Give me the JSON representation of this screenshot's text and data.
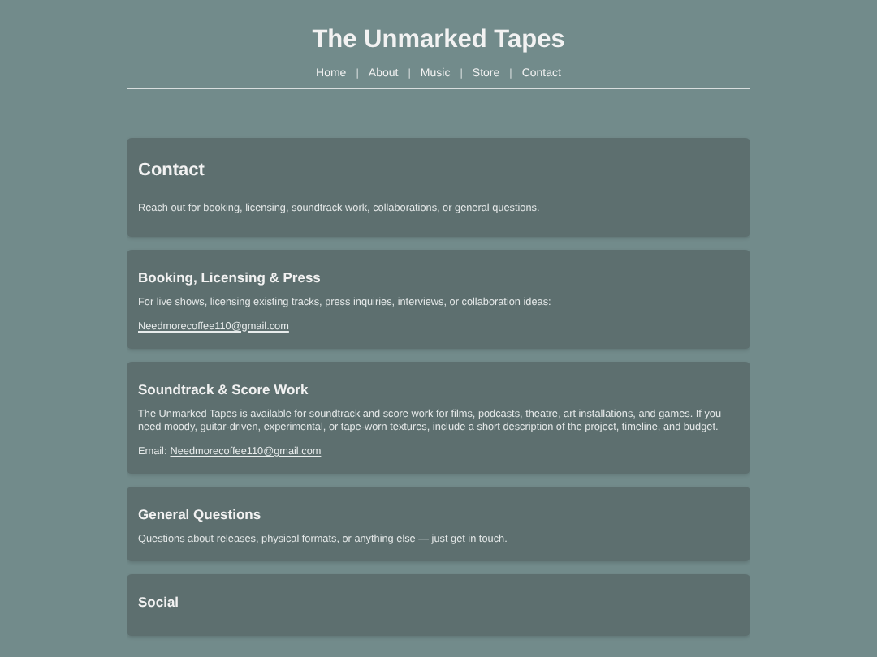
{
  "site": {
    "title": "The Unmarked Tapes"
  },
  "nav": [
    {
      "kind": "link",
      "label": "Home"
    },
    {
      "kind": "separator",
      "label": "|"
    },
    {
      "kind": "link",
      "label": "About"
    },
    {
      "kind": "separator",
      "label": "|"
    },
    {
      "kind": "link",
      "label": "Music"
    },
    {
      "kind": "separator",
      "label": "|"
    },
    {
      "kind": "link",
      "label": "Store"
    },
    {
      "kind": "separator",
      "label": "|"
    },
    {
      "kind": "link",
      "label": "Contact"
    }
  ],
  "sections": [
    {
      "kind": "main",
      "title": "Contact",
      "blocks": [
        {
          "kind": "text",
          "text": "Reach out for booking, licensing, soundtrack work, collaborations, or general questions."
        }
      ]
    },
    {
      "kind": "sub",
      "title": "Booking, Licensing & Press",
      "blocks": [
        {
          "kind": "text",
          "text": "For live shows, licensing existing tracks, press inquiries, interviews, or collaboration ideas:"
        },
        {
          "kind": "email",
          "link": "Needmorecoffee110@gmail.com"
        }
      ]
    },
    {
      "kind": "sub",
      "title": "Soundtrack & Score Work",
      "blocks": [
        {
          "kind": "text",
          "text": "The Unmarked Tapes is available for soundtrack and score work for films, podcasts, theatre, art installations, and games. If you need moody, guitar-driven, experimental, or tape-worn textures, include a short description of the project, timeline, and budget."
        },
        {
          "kind": "email",
          "prefix": "Email:",
          "link": "Needmorecoffee110@gmail.com"
        }
      ]
    },
    {
      "kind": "sub",
      "title": "General Questions",
      "blocks": [
        {
          "kind": "text",
          "text": "Questions about releases, physical formats, or anything else — just get in touch."
        }
      ]
    },
    {
      "kind": "sub",
      "title": "Social"
    }
  ]
}
